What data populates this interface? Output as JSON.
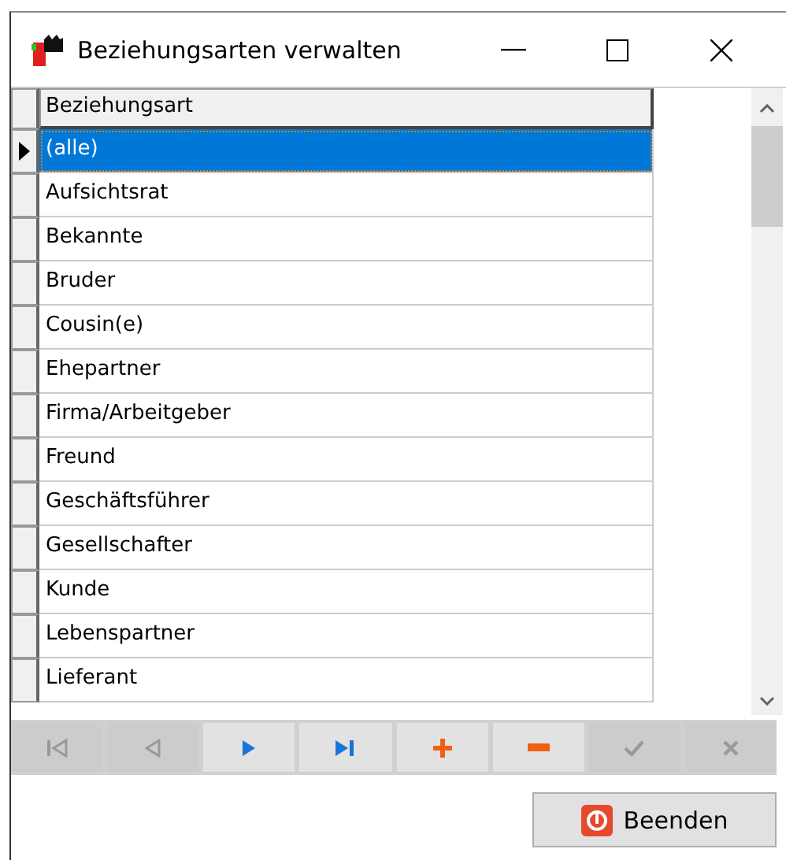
{
  "window": {
    "title": "Beziehungsarten verwalten"
  },
  "table": {
    "columns": [
      "Beziehungsart"
    ],
    "rows": [
      {
        "cell": "(alle)",
        "selected": true
      },
      {
        "cell": "Aufsichtsrat",
        "selected": false
      },
      {
        "cell": "Bekannte",
        "selected": false
      },
      {
        "cell": "Bruder",
        "selected": false
      },
      {
        "cell": "Cousin(e)",
        "selected": false
      },
      {
        "cell": "Ehepartner",
        "selected": false
      },
      {
        "cell": "Firma/Arbeitgeber",
        "selected": false
      },
      {
        "cell": "Freund",
        "selected": false
      },
      {
        "cell": "Geschäftsführer",
        "selected": false
      },
      {
        "cell": "Gesellschafter",
        "selected": false
      },
      {
        "cell": "Kunde",
        "selected": false
      },
      {
        "cell": "Lebenspartner",
        "selected": false
      },
      {
        "cell": "Lieferant",
        "selected": false
      }
    ]
  },
  "navigator": [
    {
      "kind": "first",
      "disabled": true
    },
    {
      "kind": "prior",
      "disabled": true
    },
    {
      "kind": "next",
      "disabled": false
    },
    {
      "kind": "last",
      "disabled": false
    },
    {
      "kind": "insert",
      "disabled": false
    },
    {
      "kind": "delete",
      "disabled": false
    },
    {
      "kind": "post",
      "disabled": true
    },
    {
      "kind": "cancel",
      "disabled": true
    }
  ],
  "buttons": [
    {
      "label": "Beenden"
    }
  ]
}
